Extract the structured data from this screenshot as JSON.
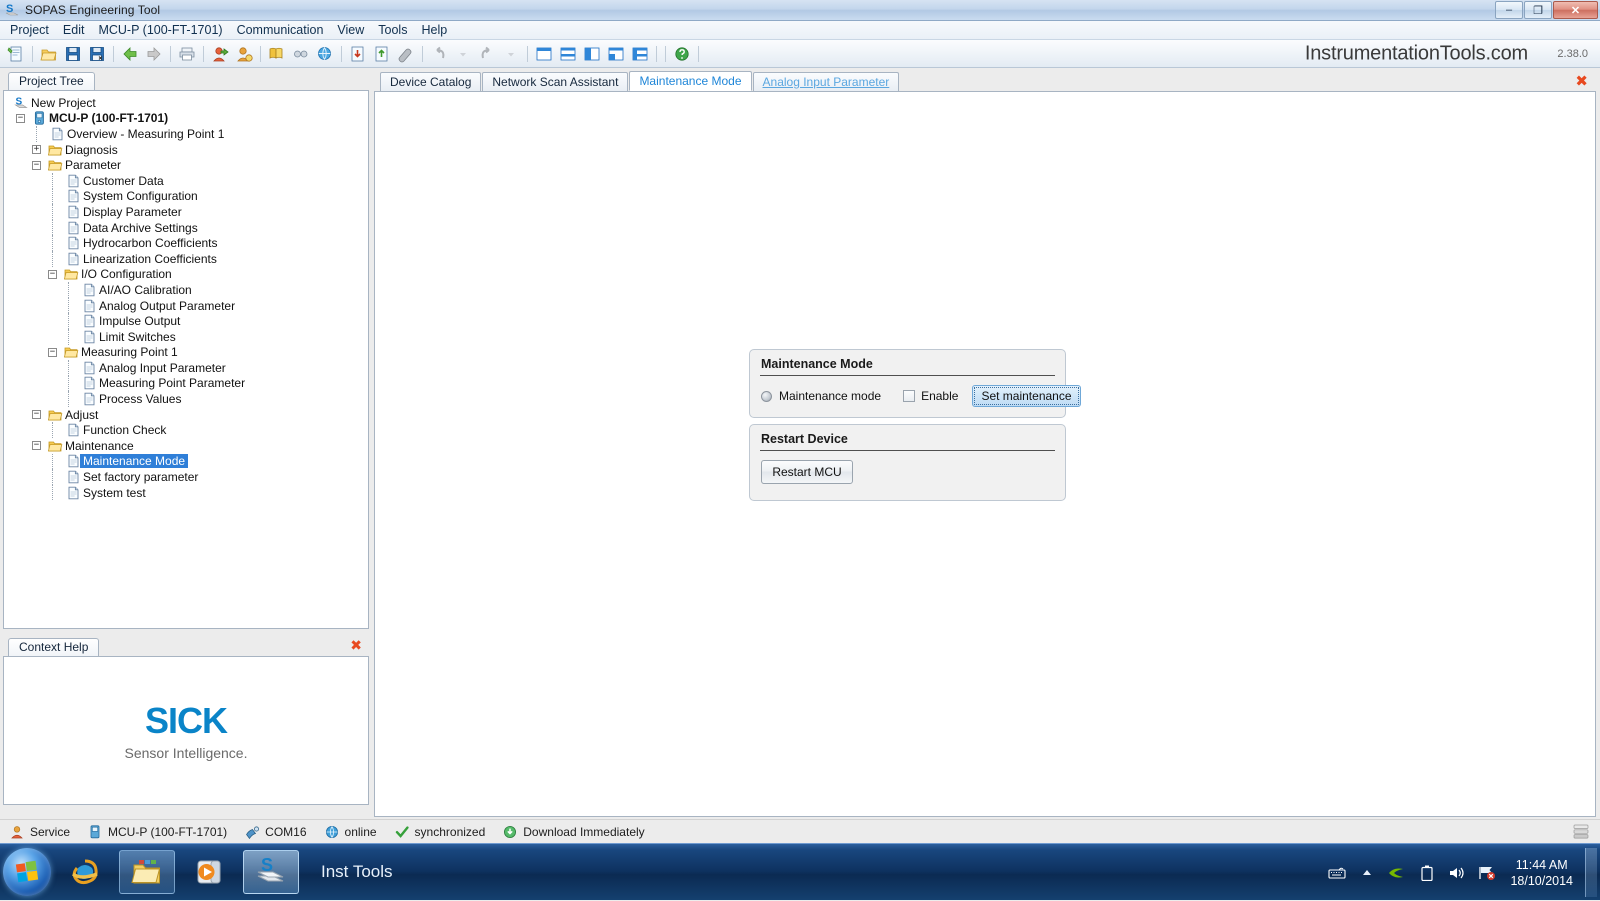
{
  "window": {
    "title": "SOPAS Engineering Tool",
    "icon": "sopas-app-icon",
    "minimize_label": "–",
    "maximize_label": "❐",
    "close_label": "✕"
  },
  "menubar": {
    "items": [
      {
        "label": "Project"
      },
      {
        "label": "Edit"
      },
      {
        "label": "MCU-P (100-FT-1701)"
      },
      {
        "label": "Communication"
      },
      {
        "label": "View"
      },
      {
        "label": "Tools"
      },
      {
        "label": "Help"
      }
    ]
  },
  "toolbar": {
    "brand": "InstrumentationTools.com",
    "version": "2.38.0",
    "icons": [
      {
        "name": "new-document-icon"
      },
      {
        "sep": true
      },
      {
        "name": "open-folder-icon"
      },
      {
        "name": "save-icon"
      },
      {
        "name": "save-as-icon"
      },
      {
        "sep": true
      },
      {
        "name": "back-arrow-icon"
      },
      {
        "name": "forward-arrow-icon"
      },
      {
        "sep": true
      },
      {
        "name": "print-icon"
      },
      {
        "sep": true
      },
      {
        "name": "user-login-icon"
      },
      {
        "name": "user-logout-icon"
      },
      {
        "sep": true
      },
      {
        "name": "device-catalog-icon"
      },
      {
        "name": "network-scan-icon"
      },
      {
        "name": "internet-scan-icon"
      },
      {
        "sep": true
      },
      {
        "name": "download-to-device-icon"
      },
      {
        "name": "upload-from-device-icon"
      },
      {
        "name": "eraser-icon"
      },
      {
        "sep": true
      },
      {
        "name": "undo-icon"
      },
      {
        "name": "undo-dropdown-icon"
      },
      {
        "name": "redo-icon"
      },
      {
        "name": "redo-dropdown-icon"
      },
      {
        "sep": true
      },
      {
        "name": "layout-single-icon"
      },
      {
        "name": "layout-horizontal-split-icon"
      },
      {
        "name": "layout-vertical-split-icon"
      },
      {
        "name": "layout-three-pane-icon"
      },
      {
        "name": "layout-four-pane-icon"
      },
      {
        "sep": true
      },
      {
        "sep": true
      },
      {
        "name": "help-icon"
      },
      {
        "sep": true
      }
    ]
  },
  "project_tree": {
    "tab_label": "Project Tree",
    "nodes": [
      {
        "label": "New Project",
        "depth": 0,
        "icon": "sopas-project-icon",
        "toggle": "none",
        "bold": false,
        "selected": false
      },
      {
        "label": "MCU-P (100-FT-1701)",
        "depth": 1,
        "icon": "device-icon",
        "toggle": "minus",
        "bold": true,
        "selected": false
      },
      {
        "label": "Overview - Measuring Point 1",
        "depth": 2,
        "icon": "document-icon",
        "toggle": "none",
        "bold": false,
        "selected": false
      },
      {
        "label": "Diagnosis",
        "depth": 2,
        "icon": "folder-icon",
        "toggle": "plus",
        "bold": false,
        "selected": false
      },
      {
        "label": "Parameter",
        "depth": 2,
        "icon": "folder-icon",
        "toggle": "minus",
        "bold": false,
        "selected": false
      },
      {
        "label": "Customer Data",
        "depth": 3,
        "icon": "document-icon",
        "toggle": "none",
        "bold": false,
        "selected": false
      },
      {
        "label": "System Configuration",
        "depth": 3,
        "icon": "document-icon",
        "toggle": "none",
        "bold": false,
        "selected": false
      },
      {
        "label": "Display Parameter",
        "depth": 3,
        "icon": "document-icon",
        "toggle": "none",
        "bold": false,
        "selected": false
      },
      {
        "label": "Data Archive Settings",
        "depth": 3,
        "icon": "document-icon",
        "toggle": "none",
        "bold": false,
        "selected": false
      },
      {
        "label": "Hydrocarbon Coefficients",
        "depth": 3,
        "icon": "document-icon",
        "toggle": "none",
        "bold": false,
        "selected": false
      },
      {
        "label": "Linearization Coefficients",
        "depth": 3,
        "icon": "document-icon",
        "toggle": "none",
        "bold": false,
        "selected": false
      },
      {
        "label": "I/O Configuration",
        "depth": 3,
        "icon": "folder-icon",
        "toggle": "minus",
        "bold": false,
        "selected": false
      },
      {
        "label": "AI/AO Calibration",
        "depth": 4,
        "icon": "document-icon",
        "toggle": "none",
        "bold": false,
        "selected": false
      },
      {
        "label": "Analog Output Parameter",
        "depth": 4,
        "icon": "document-icon",
        "toggle": "none",
        "bold": false,
        "selected": false
      },
      {
        "label": "Impulse Output",
        "depth": 4,
        "icon": "document-icon",
        "toggle": "none",
        "bold": false,
        "selected": false
      },
      {
        "label": "Limit Switches",
        "depth": 4,
        "icon": "document-icon",
        "toggle": "none",
        "bold": false,
        "selected": false
      },
      {
        "label": "Measuring Point 1",
        "depth": 3,
        "icon": "folder-icon",
        "toggle": "minus",
        "bold": false,
        "selected": false
      },
      {
        "label": "Analog Input Parameter",
        "depth": 4,
        "icon": "document-icon",
        "toggle": "none",
        "bold": false,
        "selected": false
      },
      {
        "label": "Measuring Point Parameter",
        "depth": 4,
        "icon": "document-icon",
        "toggle": "none",
        "bold": false,
        "selected": false
      },
      {
        "label": "Process Values",
        "depth": 4,
        "icon": "document-icon",
        "toggle": "none",
        "bold": false,
        "selected": false
      },
      {
        "label": "Adjust",
        "depth": 2,
        "icon": "folder-icon",
        "toggle": "minus",
        "bold": false,
        "selected": false
      },
      {
        "label": "Function Check",
        "depth": 3,
        "icon": "document-icon",
        "toggle": "none",
        "bold": false,
        "selected": false
      },
      {
        "label": "Maintenance",
        "depth": 2,
        "icon": "folder-icon",
        "toggle": "minus",
        "bold": false,
        "selected": false
      },
      {
        "label": "Maintenance Mode",
        "depth": 3,
        "icon": "document-icon",
        "toggle": "none",
        "bold": false,
        "selected": true
      },
      {
        "label": "Set factory parameter",
        "depth": 3,
        "icon": "document-icon",
        "toggle": "none",
        "bold": false,
        "selected": false
      },
      {
        "label": "System test",
        "depth": 3,
        "icon": "document-icon",
        "toggle": "none",
        "bold": false,
        "selected": false
      }
    ]
  },
  "context_help": {
    "tab_label": "Context Help",
    "close_label": "✖",
    "logo_text": "SICK",
    "tagline": "Sensor Intelligence.",
    "logo_color": "#0a84c8"
  },
  "main": {
    "close_label": "✖",
    "tabs": [
      {
        "label": "Device Catalog",
        "state": "normal"
      },
      {
        "label": "Network Scan Assistant",
        "state": "normal"
      },
      {
        "label": "Maintenance Mode",
        "state": "active"
      },
      {
        "label": "Analog Input Parameter",
        "state": "link"
      }
    ],
    "groups": [
      {
        "title": "Maintenance Mode",
        "led_label": "Maintenance mode",
        "led_state": "off",
        "checkbox_label": "Enable",
        "checkbox_checked": false,
        "button_label": "Set maintenance",
        "button_focused": true
      },
      {
        "title": "Restart Device",
        "button_label": "Restart MCU"
      }
    ]
  },
  "statusbar": {
    "items": [
      {
        "icon": "user-icon",
        "text": "Service"
      },
      {
        "icon": "device-icon",
        "text": "MCU-P (100-FT-1701)"
      },
      {
        "icon": "com-port-icon",
        "text": "COM16"
      },
      {
        "icon": "globe-icon",
        "text": "online"
      },
      {
        "icon": "check-icon",
        "text": "synchronized"
      },
      {
        "icon": "download-icon",
        "text": "Download Immediately"
      }
    ],
    "right_icon": "server-stack-icon"
  },
  "taskbar": {
    "start_label": "start-orb",
    "apps": [
      {
        "name": "internet-explorer-icon",
        "state": "normal"
      },
      {
        "name": "file-explorer-icon",
        "state": "pinned"
      },
      {
        "name": "media-player-icon",
        "state": "normal"
      },
      {
        "name": "sopas-icon",
        "state": "active"
      }
    ],
    "active_window_title": "Inst Tools",
    "tray": [
      {
        "name": "keyboard-icon"
      },
      {
        "name": "show-hidden-icons-icon"
      },
      {
        "name": "nvidia-icon"
      },
      {
        "name": "battery-icon"
      },
      {
        "name": "volume-icon"
      },
      {
        "name": "action-center-icon"
      }
    ],
    "time": "11:44 AM",
    "date": "18/10/2014"
  }
}
